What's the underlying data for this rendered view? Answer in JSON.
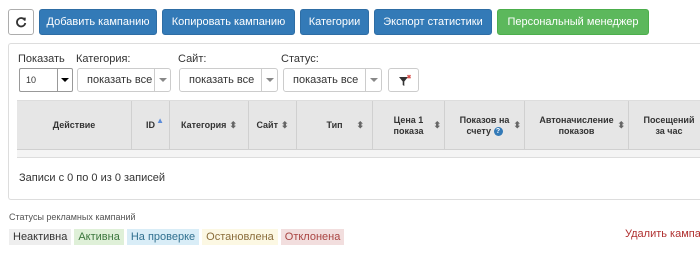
{
  "toolbar": {
    "add_label": "Добавить кампанию",
    "copy_label": "Копировать кампанию",
    "categories_label": "Категории",
    "export_label": "Экспорт статистики",
    "manager_label": "Персональный менеджер"
  },
  "filters": {
    "show_label": "Показать",
    "page_size_value": "10",
    "category_label": "Категория:",
    "category_value": "показать все",
    "site_label": "Сайт:",
    "site_value": "показать все",
    "status_label": "Статус:",
    "status_value": "показать все"
  },
  "table": {
    "columns": {
      "action": "Действие",
      "id": "ID",
      "category": "Категория",
      "site": "Сайт",
      "type": "Тип",
      "price_line1": "Цена 1",
      "price_line2": "показа",
      "impressions_line1": "Показов на",
      "impressions_line2": "счету",
      "auto_line1": "Автоначисление",
      "auto_line2": "показов",
      "visits_line1": "Посещений",
      "visits_line2": "за час"
    },
    "info_text": "Записи с 0 по 0 из 0 записей"
  },
  "statuses": {
    "title": "Статусы рекламных кампаний",
    "items": [
      {
        "label": "Неактивна",
        "bg": "#eeeeee",
        "fg": "#333333"
      },
      {
        "label": "Активна",
        "bg": "#dff0d8",
        "fg": "#3c763d"
      },
      {
        "label": "На проверке",
        "bg": "#d9edf7",
        "fg": "#31708f"
      },
      {
        "label": "Остановлена",
        "bg": "#fcf8e3",
        "fg": "#8a6d3b"
      },
      {
        "label": "Отклонена",
        "bg": "#f2dede",
        "fg": "#a94442"
      }
    ]
  },
  "delete_link": "Удалить кампа"
}
